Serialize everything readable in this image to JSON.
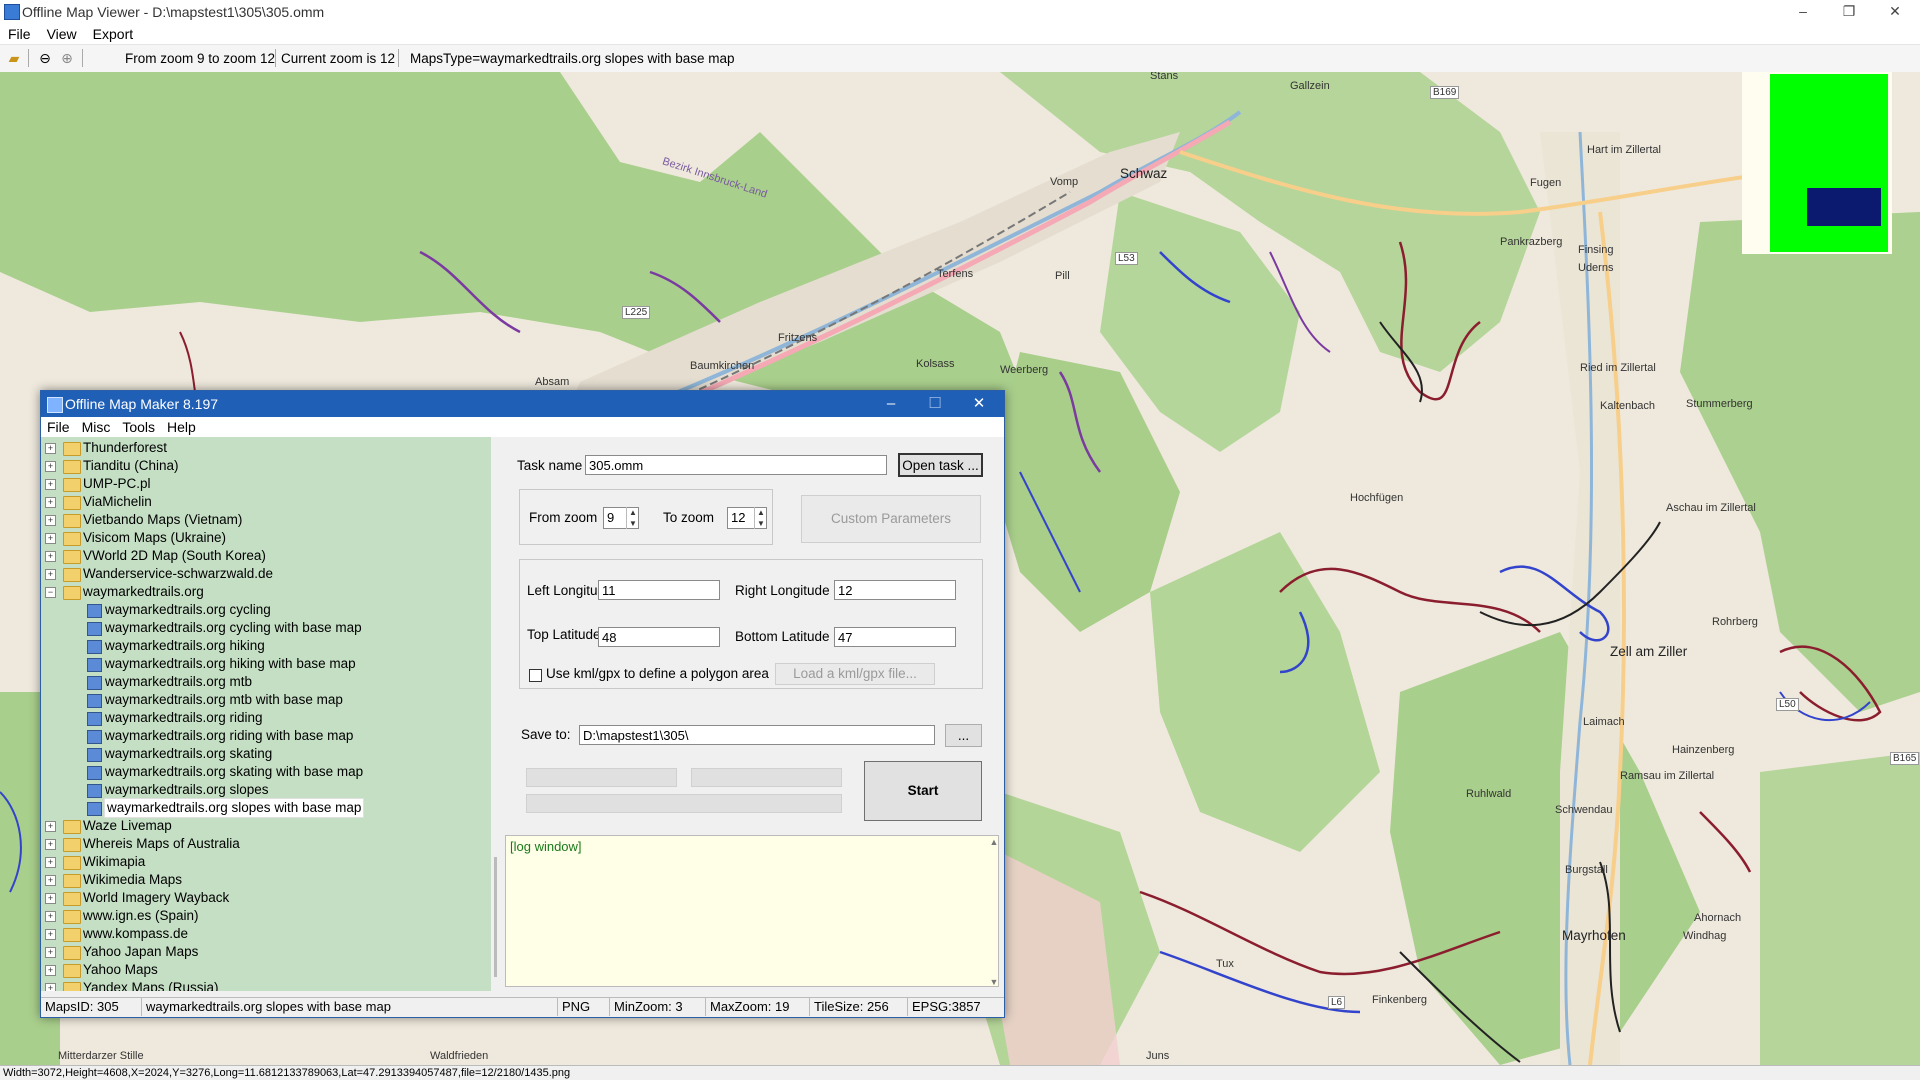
{
  "window": {
    "title": "Offline Map Viewer - D:\\mapstest1\\305\\305.omm",
    "minimize": "–",
    "restore": "❐",
    "close": "✕"
  },
  "menubar": {
    "file": "File",
    "view": "View",
    "export": "Export"
  },
  "toolbar": {
    "zoom_range": "From zoom 9 to zoom 12",
    "current_zoom": "Current zoom is 12",
    "maps_type": "MapsType=waymarkedtrails.org slopes with base map"
  },
  "map": {
    "labels": [
      "Stans",
      "Gallzein",
      "Schwaz",
      "Vomp",
      "Fugen",
      "Hart im Zillertal",
      "Pankrazberg",
      "Finsing",
      "Uderns",
      "Terfens",
      "Pill",
      "Fritzens",
      "Baumkirchen",
      "Kolsass",
      "Weerberg",
      "Absam",
      "Ried im Zillertal",
      "Kaltenbach",
      "Stummerberg",
      "Hochfügen",
      "Aschau im Zillertal",
      "Rohrberg",
      "Laimach",
      "Hainzenberg",
      "Ramsau im Zillertal",
      "Schwendau",
      "Burgstall",
      "Ahornach",
      "Mayrhofen",
      "Windhag",
      "Tux",
      "Finkenberg",
      "Juns",
      "Ruhlwald",
      "Mitterdarzer Stille",
      "Waldfrieden",
      "Bezirk Innsbruck-Land"
    ],
    "big_labels": [
      "Schwaz",
      "Zell am Ziller",
      "Mayrhofen"
    ],
    "roads": [
      "B169",
      "L225",
      "L53",
      "L50",
      "B165",
      "L6"
    ]
  },
  "statusbar": "Width=3072,Height=4608,X=2024,Y=3276,Long=11.6812133789063,Lat=47.2913394057487,file=12/2180/1435.png",
  "dialog": {
    "title": "Offline Map Maker 8.197",
    "menu": {
      "file": "File",
      "misc": "Misc",
      "tools": "Tools",
      "help": "Help"
    },
    "tree_top": [
      "Thunderforest",
      "Tianditu (China)",
      "UMP-PC.pl",
      "ViaMichelin",
      "Vietbando Maps (Vietnam)",
      "Visicom Maps (Ukraine)",
      "VWorld 2D Map (South Korea)",
      "Wanderservice-schwarzwald.de"
    ],
    "tree_expanded": "waymarkedtrails.org",
    "tree_children": [
      "waymarkedtrails.org cycling",
      "waymarkedtrails.org cycling with base map",
      "waymarkedtrails.org hiking",
      "waymarkedtrails.org hiking with base map",
      "waymarkedtrails.org mtb",
      "waymarkedtrails.org mtb with base map",
      "waymarkedtrails.org riding",
      "waymarkedtrails.org riding with base map",
      "waymarkedtrails.org skating",
      "waymarkedtrails.org skating with base map",
      "waymarkedtrails.org slopes",
      "waymarkedtrails.org slopes with base map"
    ],
    "tree_bottom": [
      "Waze Livemap",
      "Whereis Maps of Australia",
      "Wikimapia",
      "Wikimedia Maps",
      "World Imagery Wayback",
      "www.ign.es (Spain)",
      "www.kompass.de",
      "Yahoo Japan Maps",
      "Yahoo Maps",
      "Yandex Maps (Russia)"
    ],
    "task_label": "Task name",
    "task_value": "305.omm",
    "open_task": "Open task ...",
    "from_zoom_label": "From zoom",
    "from_zoom": "9",
    "to_zoom_label": "To zoom",
    "to_zoom": "12",
    "custom_params": "Custom Parameters",
    "left_lon_label": "Left Longitude",
    "left_lon": "11",
    "right_lon_label": "Right Longitude",
    "right_lon": "12",
    "top_lat_label": "Top Latitude",
    "top_lat": "48",
    "bottom_lat_label": "Bottom Latitude",
    "bottom_lat": "47",
    "kml_label": "Use kml/gpx to define a polygon area",
    "load_kml": "Load a kml/gpx file...",
    "save_label": "Save to:",
    "save_path": "D:\\mapstest1\\305\\",
    "browse": "...",
    "start": "Start",
    "log": "[log window]",
    "status": {
      "maps_id": "MapsID: 305",
      "name": "waymarkedtrails.org slopes with base map",
      "format": "PNG",
      "min_zoom": "MinZoom: 3",
      "max_zoom": "MaxZoom: 19",
      "tile_size": "TileSize: 256",
      "epsg": "EPSG:3857"
    }
  }
}
